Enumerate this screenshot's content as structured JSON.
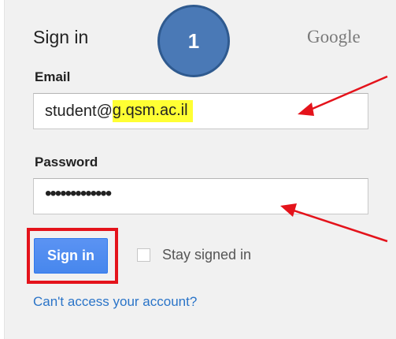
{
  "login": {
    "heading": "Sign in",
    "brand": "Google",
    "step_number": "1",
    "email_label": "Email",
    "email_value_prefix": "student@",
    "email_value_domain": "g.qsm.ac.il",
    "password_label": "Password",
    "password_masked": "•••••••••••••",
    "submit_label": "Sign in",
    "stay_signed_in_label": "Stay signed in",
    "stay_signed_in_checked": false,
    "help_link": "Can't access your account?"
  },
  "colors": {
    "panel_background": "#f1f1f1",
    "button_blue": "#4787ed",
    "highlight_yellow": "#ffff33",
    "annotation_red": "#e4131b",
    "badge_blue": "#4a79b6",
    "link_blue": "#2a74c8"
  },
  "icons": {
    "email_pointer": "red-arrow-icon",
    "password_pointer": "red-arrow-icon"
  }
}
